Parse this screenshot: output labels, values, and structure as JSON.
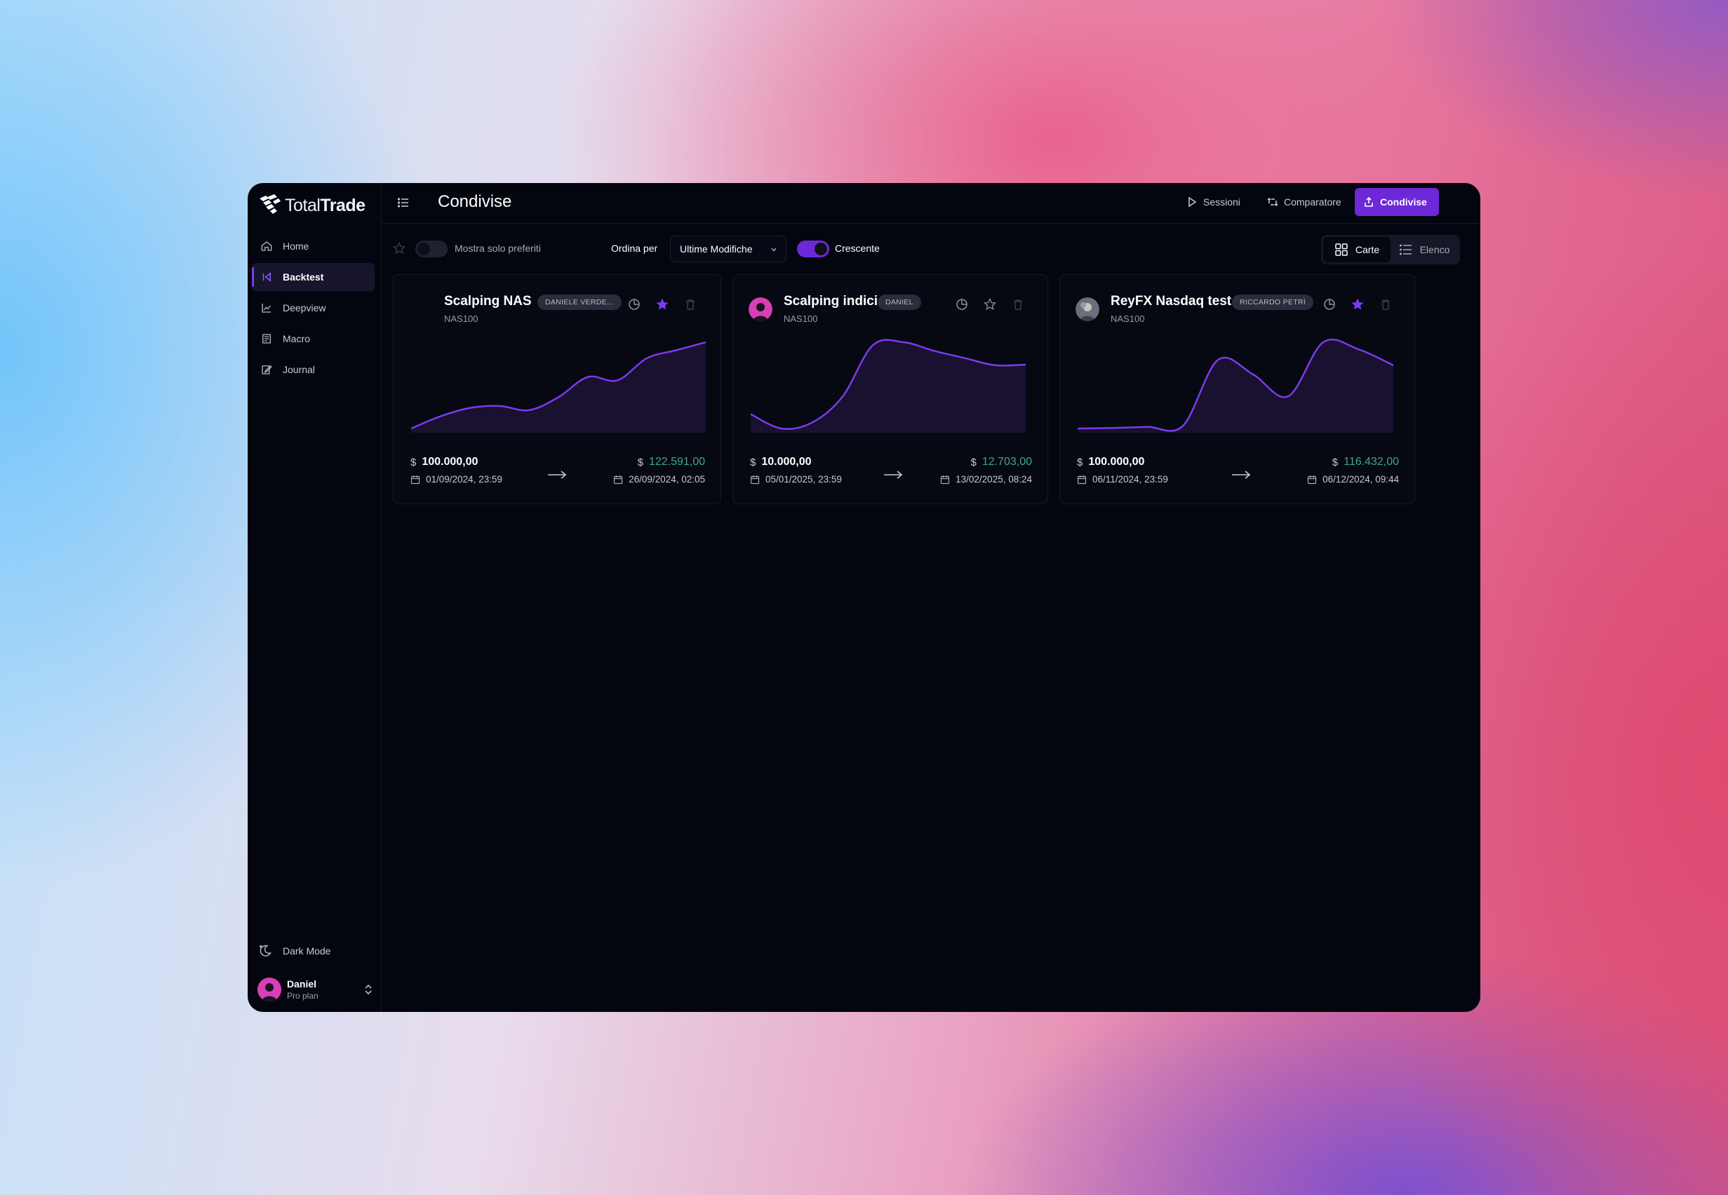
{
  "app": {
    "brand": {
      "light": "Total",
      "bold": "Trade"
    },
    "accent": "#6d28d9"
  },
  "sidebar": {
    "items": [
      {
        "label": "Home",
        "icon": "home-icon",
        "active": false
      },
      {
        "label": "Backtest",
        "icon": "backtest-icon",
        "active": true
      },
      {
        "label": "Deepview",
        "icon": "chart-icon",
        "active": false
      },
      {
        "label": "Macro",
        "icon": "news-icon",
        "active": false
      },
      {
        "label": "Journal",
        "icon": "journal-icon",
        "active": false
      }
    ],
    "dark_mode_label": "Dark Mode",
    "user": {
      "name": "Daniel",
      "plan": "Pro plan"
    }
  },
  "header": {
    "title": "Condivise",
    "sessioni": "Sessioni",
    "comparatore": "Comparatore",
    "condivise": "Condivise"
  },
  "toolbar": {
    "fav_label": "Mostra solo preferiti",
    "sort_label": "Ordina per",
    "sort_value": "Ultime Modifiche",
    "asc_label": "Crescente",
    "view_cards": "Carte",
    "view_list": "Elenco"
  },
  "cards": [
    {
      "title": "Scalping NAS",
      "badge": "DANIELE VERDE...",
      "symbol": "NAS100",
      "favorite": true,
      "start_amount": "100.000,00",
      "end_amount": "122.591,00",
      "start_date": "01/09/2024, 23:59",
      "end_date": "26/09/2024, 02:05",
      "currency": "$",
      "equity": [
        100000,
        103200,
        105400,
        105900,
        104800,
        108200,
        113500,
        112600,
        118400,
        120500,
        122591
      ]
    },
    {
      "title": "Scalping indici",
      "badge": "DANIEL",
      "symbol": "NAS100",
      "favorite": false,
      "start_amount": "10.000,00",
      "end_amount": "12.703,00",
      "start_date": "05/01/2025, 23:59",
      "end_date": "13/02/2025, 08:24",
      "currency": "$",
      "equity": [
        10500,
        10000,
        10200,
        11100,
        12900,
        13000,
        12700,
        12450,
        12200,
        12220
      ]
    },
    {
      "title": "ReyFX Nasdaq test",
      "badge": "RICCARDO PETRÌ",
      "symbol": "NAS100",
      "favorite": true,
      "start_amount": "100.000,00",
      "end_amount": "116.432,00",
      "start_date": "06/11/2024, 23:59",
      "end_date": "06/12/2024, 09:44",
      "currency": "$",
      "equity": [
        100000,
        100100,
        100300,
        100500,
        112800,
        110100,
        106000,
        116100,
        114800,
        111800
      ]
    }
  ],
  "colors": {
    "line": "#7c3aed",
    "profit": "#3fa88a",
    "favorite": "#7c3aed"
  }
}
